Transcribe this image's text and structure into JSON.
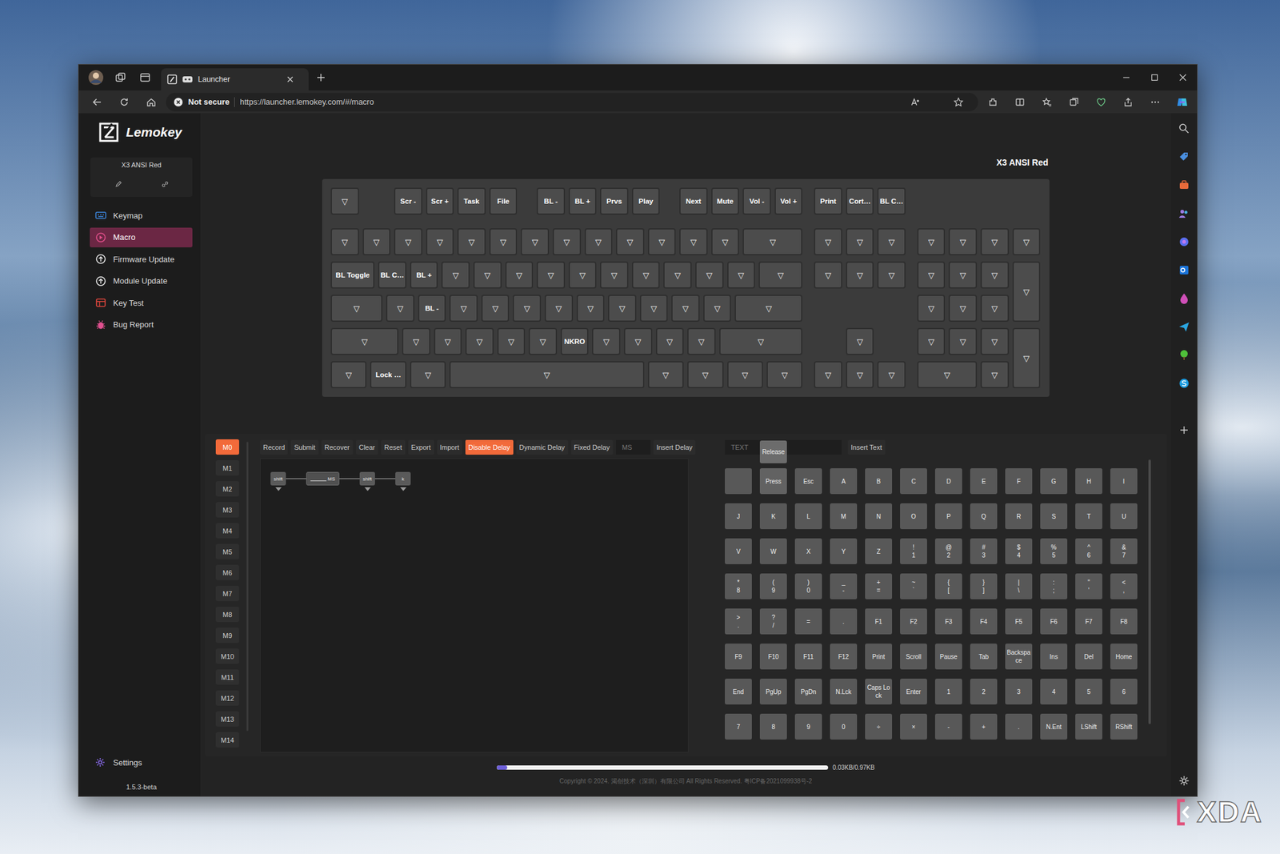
{
  "desktop": {
    "watermark": "XDA"
  },
  "browser": {
    "tab": {
      "title": "Launcher"
    },
    "address": {
      "security": "Not secure",
      "url": "https://launcher.lemokey.com/#/macro"
    }
  },
  "app": {
    "logo": "Lemokey",
    "device": "X3 ANSI Red",
    "sidebar": [
      {
        "label": "Keymap",
        "selected": false
      },
      {
        "label": "Macro",
        "selected": true
      },
      {
        "label": "Firmware Update",
        "selected": false
      },
      {
        "label": "Module Update",
        "selected": false
      },
      {
        "label": "Key Test",
        "selected": false
      },
      {
        "label": "Bug Report",
        "selected": false
      }
    ],
    "settings": "Settings",
    "version": "1.5.3-beta"
  },
  "keyboard": {
    "title": "X3 ANSI Red",
    "rows": [
      [
        "▽",
        "Scr -",
        "Scr +",
        "Task",
        "File",
        "BL -",
        "BL +",
        "Prvs",
        "Play",
        "Next",
        "Mute",
        "Vol -",
        "Vol +",
        "Print",
        "Cort…",
        "BL C…"
      ],
      [
        "▽",
        "▽",
        "▽",
        "▽",
        "▽",
        "▽",
        "▽",
        "▽",
        "▽",
        "▽",
        "▽",
        "▽",
        "▽",
        "▽",
        "▽",
        "▽",
        "▽",
        "▽",
        "▽",
        "▽",
        "▽"
      ],
      [
        "BL Toggle",
        "BL C…",
        "BL +",
        "▽",
        "▽",
        "▽",
        "▽",
        "▽",
        "▽",
        "▽",
        "▽",
        "▽",
        "▽",
        "▽",
        "▽",
        "▽",
        "▽",
        "▽",
        "▽",
        "▽",
        "▽"
      ],
      [
        "▽",
        "▽",
        "BL -",
        "▽",
        "▽",
        "▽",
        "▽",
        "▽",
        "▽",
        "▽",
        "▽",
        "▽",
        "▽",
        "▽",
        "▽",
        "▽"
      ],
      [
        "▽",
        "▽",
        "▽",
        "▽",
        "▽",
        "▽",
        "NKRO",
        "▽",
        "▽",
        "▽",
        "▽",
        "▽",
        "▽",
        "▽",
        "▽",
        "▽",
        "▽"
      ],
      [
        "▽",
        "Lock …",
        "▽",
        "▽",
        "▽",
        "▽",
        "▽",
        "▽",
        "▽",
        "▽",
        "▽",
        "▽",
        "▽"
      ]
    ]
  },
  "macro": {
    "slots": [
      {
        "label": "M0",
        "selected": true
      },
      {
        "label": "M1",
        "selected": false
      },
      {
        "label": "M2",
        "selected": false
      },
      {
        "label": "M3",
        "selected": false
      },
      {
        "label": "M4",
        "selected": false
      },
      {
        "label": "M5",
        "selected": false
      },
      {
        "label": "M6",
        "selected": false
      },
      {
        "label": "M7",
        "selected": false
      },
      {
        "label": "M8",
        "selected": false
      },
      {
        "label": "M9",
        "selected": false
      },
      {
        "label": "M10",
        "selected": false
      },
      {
        "label": "M11",
        "selected": false
      },
      {
        "label": "M12",
        "selected": false
      },
      {
        "label": "M13",
        "selected": false
      },
      {
        "label": "M14",
        "selected": false
      }
    ],
    "toolbar_left": [
      {
        "kind": "button",
        "label": "Record",
        "selected": false
      },
      {
        "kind": "button",
        "label": "Submit",
        "selected": false
      },
      {
        "kind": "button",
        "label": "Recover",
        "selected": false
      },
      {
        "kind": "button",
        "label": "Clear",
        "selected": false
      },
      {
        "kind": "button",
        "label": "Reset",
        "selected": false
      },
      {
        "kind": "button",
        "label": "Export",
        "selected": false
      },
      {
        "kind": "button",
        "label": "Import",
        "selected": false
      },
      {
        "kind": "button",
        "label": "Disable Delay",
        "selected": true
      },
      {
        "kind": "button",
        "label": "Dynamic Delay",
        "selected": false
      },
      {
        "kind": "button",
        "label": "Fixed Delay",
        "selected": false
      },
      {
        "kind": "input",
        "placeholder": "MS"
      },
      {
        "kind": "button",
        "label": "Insert Delay",
        "selected": false
      }
    ],
    "toolbar_right": [
      {
        "kind": "input",
        "placeholder": "TEXT"
      },
      {
        "kind": "button",
        "label": "Insert Text",
        "selected": false
      }
    ],
    "steps": [
      {
        "kind": "key",
        "label": "shift"
      },
      {
        "kind": "delay",
        "label": "MS"
      },
      {
        "kind": "key",
        "label": "shift"
      },
      {
        "kind": "key",
        "label": "k"
      }
    ],
    "palette": [
      {
        "kind": "blank"
      },
      {
        "kind": "select",
        "value": "Press",
        "popup": "Release"
      },
      {
        "kind": "key",
        "label": "Esc"
      },
      {
        "kind": "key",
        "label": "A"
      },
      {
        "kind": "key",
        "label": "B"
      },
      {
        "kind": "key",
        "label": "C"
      },
      {
        "kind": "key",
        "label": "D"
      },
      {
        "kind": "key",
        "label": "E"
      },
      {
        "kind": "key",
        "label": "F"
      },
      {
        "kind": "key",
        "label": "G"
      },
      {
        "kind": "key",
        "label": "H"
      },
      {
        "kind": "key",
        "label": "I"
      },
      {
        "kind": "key",
        "label": "J"
      },
      {
        "kind": "key",
        "label": "K"
      },
      {
        "kind": "key",
        "label": "L"
      },
      {
        "kind": "key",
        "label": "M"
      },
      {
        "kind": "key",
        "label": "N"
      },
      {
        "kind": "key",
        "label": "O"
      },
      {
        "kind": "key",
        "label": "P"
      },
      {
        "kind": "key",
        "label": "Q"
      },
      {
        "kind": "key",
        "label": "R"
      },
      {
        "kind": "key",
        "label": "S"
      },
      {
        "kind": "key",
        "label": "T"
      },
      {
        "kind": "key",
        "label": "U"
      },
      {
        "kind": "key",
        "label": "V"
      },
      {
        "kind": "key",
        "label": "W"
      },
      {
        "kind": "key",
        "label": "X"
      },
      {
        "kind": "key",
        "label": "Y"
      },
      {
        "kind": "key",
        "label": "Z"
      },
      {
        "kind": "key",
        "label": "!\n1"
      },
      {
        "kind": "key",
        "label": "@\n2"
      },
      {
        "kind": "key",
        "label": "#\n3"
      },
      {
        "kind": "key",
        "label": "$\n4"
      },
      {
        "kind": "key",
        "label": "%\n5"
      },
      {
        "kind": "key",
        "label": "^\n6"
      },
      {
        "kind": "key",
        "label": "&\n7"
      },
      {
        "kind": "key",
        "label": "*\n8"
      },
      {
        "kind": "key",
        "label": "(\n9"
      },
      {
        "kind": "key",
        "label": ")\n0"
      },
      {
        "kind": "key",
        "label": "_\n-"
      },
      {
        "kind": "key",
        "label": "+\n="
      },
      {
        "kind": "key",
        "label": "~\n`"
      },
      {
        "kind": "key",
        "label": "{\n["
      },
      {
        "kind": "key",
        "label": "}\n]"
      },
      {
        "kind": "key",
        "label": "|\n\\"
      },
      {
        "kind": "key",
        "label": ":\n;"
      },
      {
        "kind": "key",
        "label": "\"\n'"
      },
      {
        "kind": "key",
        "label": "<\n,"
      },
      {
        "kind": "key",
        "label": ">\n."
      },
      {
        "kind": "key",
        "label": "?\n/"
      },
      {
        "kind": "key",
        "label": "="
      },
      {
        "kind": "key",
        "label": "."
      },
      {
        "kind": "key",
        "label": "F1"
      },
      {
        "kind": "key",
        "label": "F2"
      },
      {
        "kind": "key",
        "label": "F3"
      },
      {
        "kind": "key",
        "label": "F4"
      },
      {
        "kind": "key",
        "label": "F5"
      },
      {
        "kind": "key",
        "label": "F6"
      },
      {
        "kind": "key",
        "label": "F7"
      },
      {
        "kind": "key",
        "label": "F8"
      },
      {
        "kind": "key",
        "label": "F9"
      },
      {
        "kind": "key",
        "label": "F10"
      },
      {
        "kind": "key",
        "label": "F11"
      },
      {
        "kind": "key",
        "label": "F12"
      },
      {
        "kind": "key",
        "label": "Print"
      },
      {
        "kind": "key",
        "label": "Scroll"
      },
      {
        "kind": "key",
        "label": "Pause"
      },
      {
        "kind": "key",
        "label": "Tab"
      },
      {
        "kind": "key",
        "label": "Backspace"
      },
      {
        "kind": "key",
        "label": "Ins"
      },
      {
        "kind": "key",
        "label": "Del"
      },
      {
        "kind": "key",
        "label": "Home"
      },
      {
        "kind": "key",
        "label": "End"
      },
      {
        "kind": "key",
        "label": "PgUp"
      },
      {
        "kind": "key",
        "label": "PgDn"
      },
      {
        "kind": "key",
        "label": "N.Lck"
      },
      {
        "kind": "key",
        "label": "Caps Lock"
      },
      {
        "kind": "key",
        "label": "Enter"
      },
      {
        "kind": "key",
        "label": "1"
      },
      {
        "kind": "key",
        "label": "2"
      },
      {
        "kind": "key",
        "label": "3"
      },
      {
        "kind": "key",
        "label": "4"
      },
      {
        "kind": "key",
        "label": "5"
      },
      {
        "kind": "key",
        "label": "6"
      },
      {
        "kind": "key",
        "label": "7"
      },
      {
        "kind": "key",
        "label": "8"
      },
      {
        "kind": "key",
        "label": "9"
      },
      {
        "kind": "key",
        "label": "0"
      },
      {
        "kind": "key",
        "label": "÷"
      },
      {
        "kind": "key",
        "label": "×"
      },
      {
        "kind": "key",
        "label": "-"
      },
      {
        "kind": "key",
        "label": "+"
      },
      {
        "kind": "key",
        "label": "."
      },
      {
        "kind": "key",
        "label": "N.Ent"
      },
      {
        "kind": "key",
        "label": "LShift"
      },
      {
        "kind": "key",
        "label": "RShift"
      }
    ],
    "memory": {
      "level": 0.031,
      "reading": "0.03KB/0.97KB"
    }
  },
  "footer": "Copyright © 2024. 渴创技术（深圳）有限公司 All Rights Reserved. 粤ICP备2021099938号-2"
}
